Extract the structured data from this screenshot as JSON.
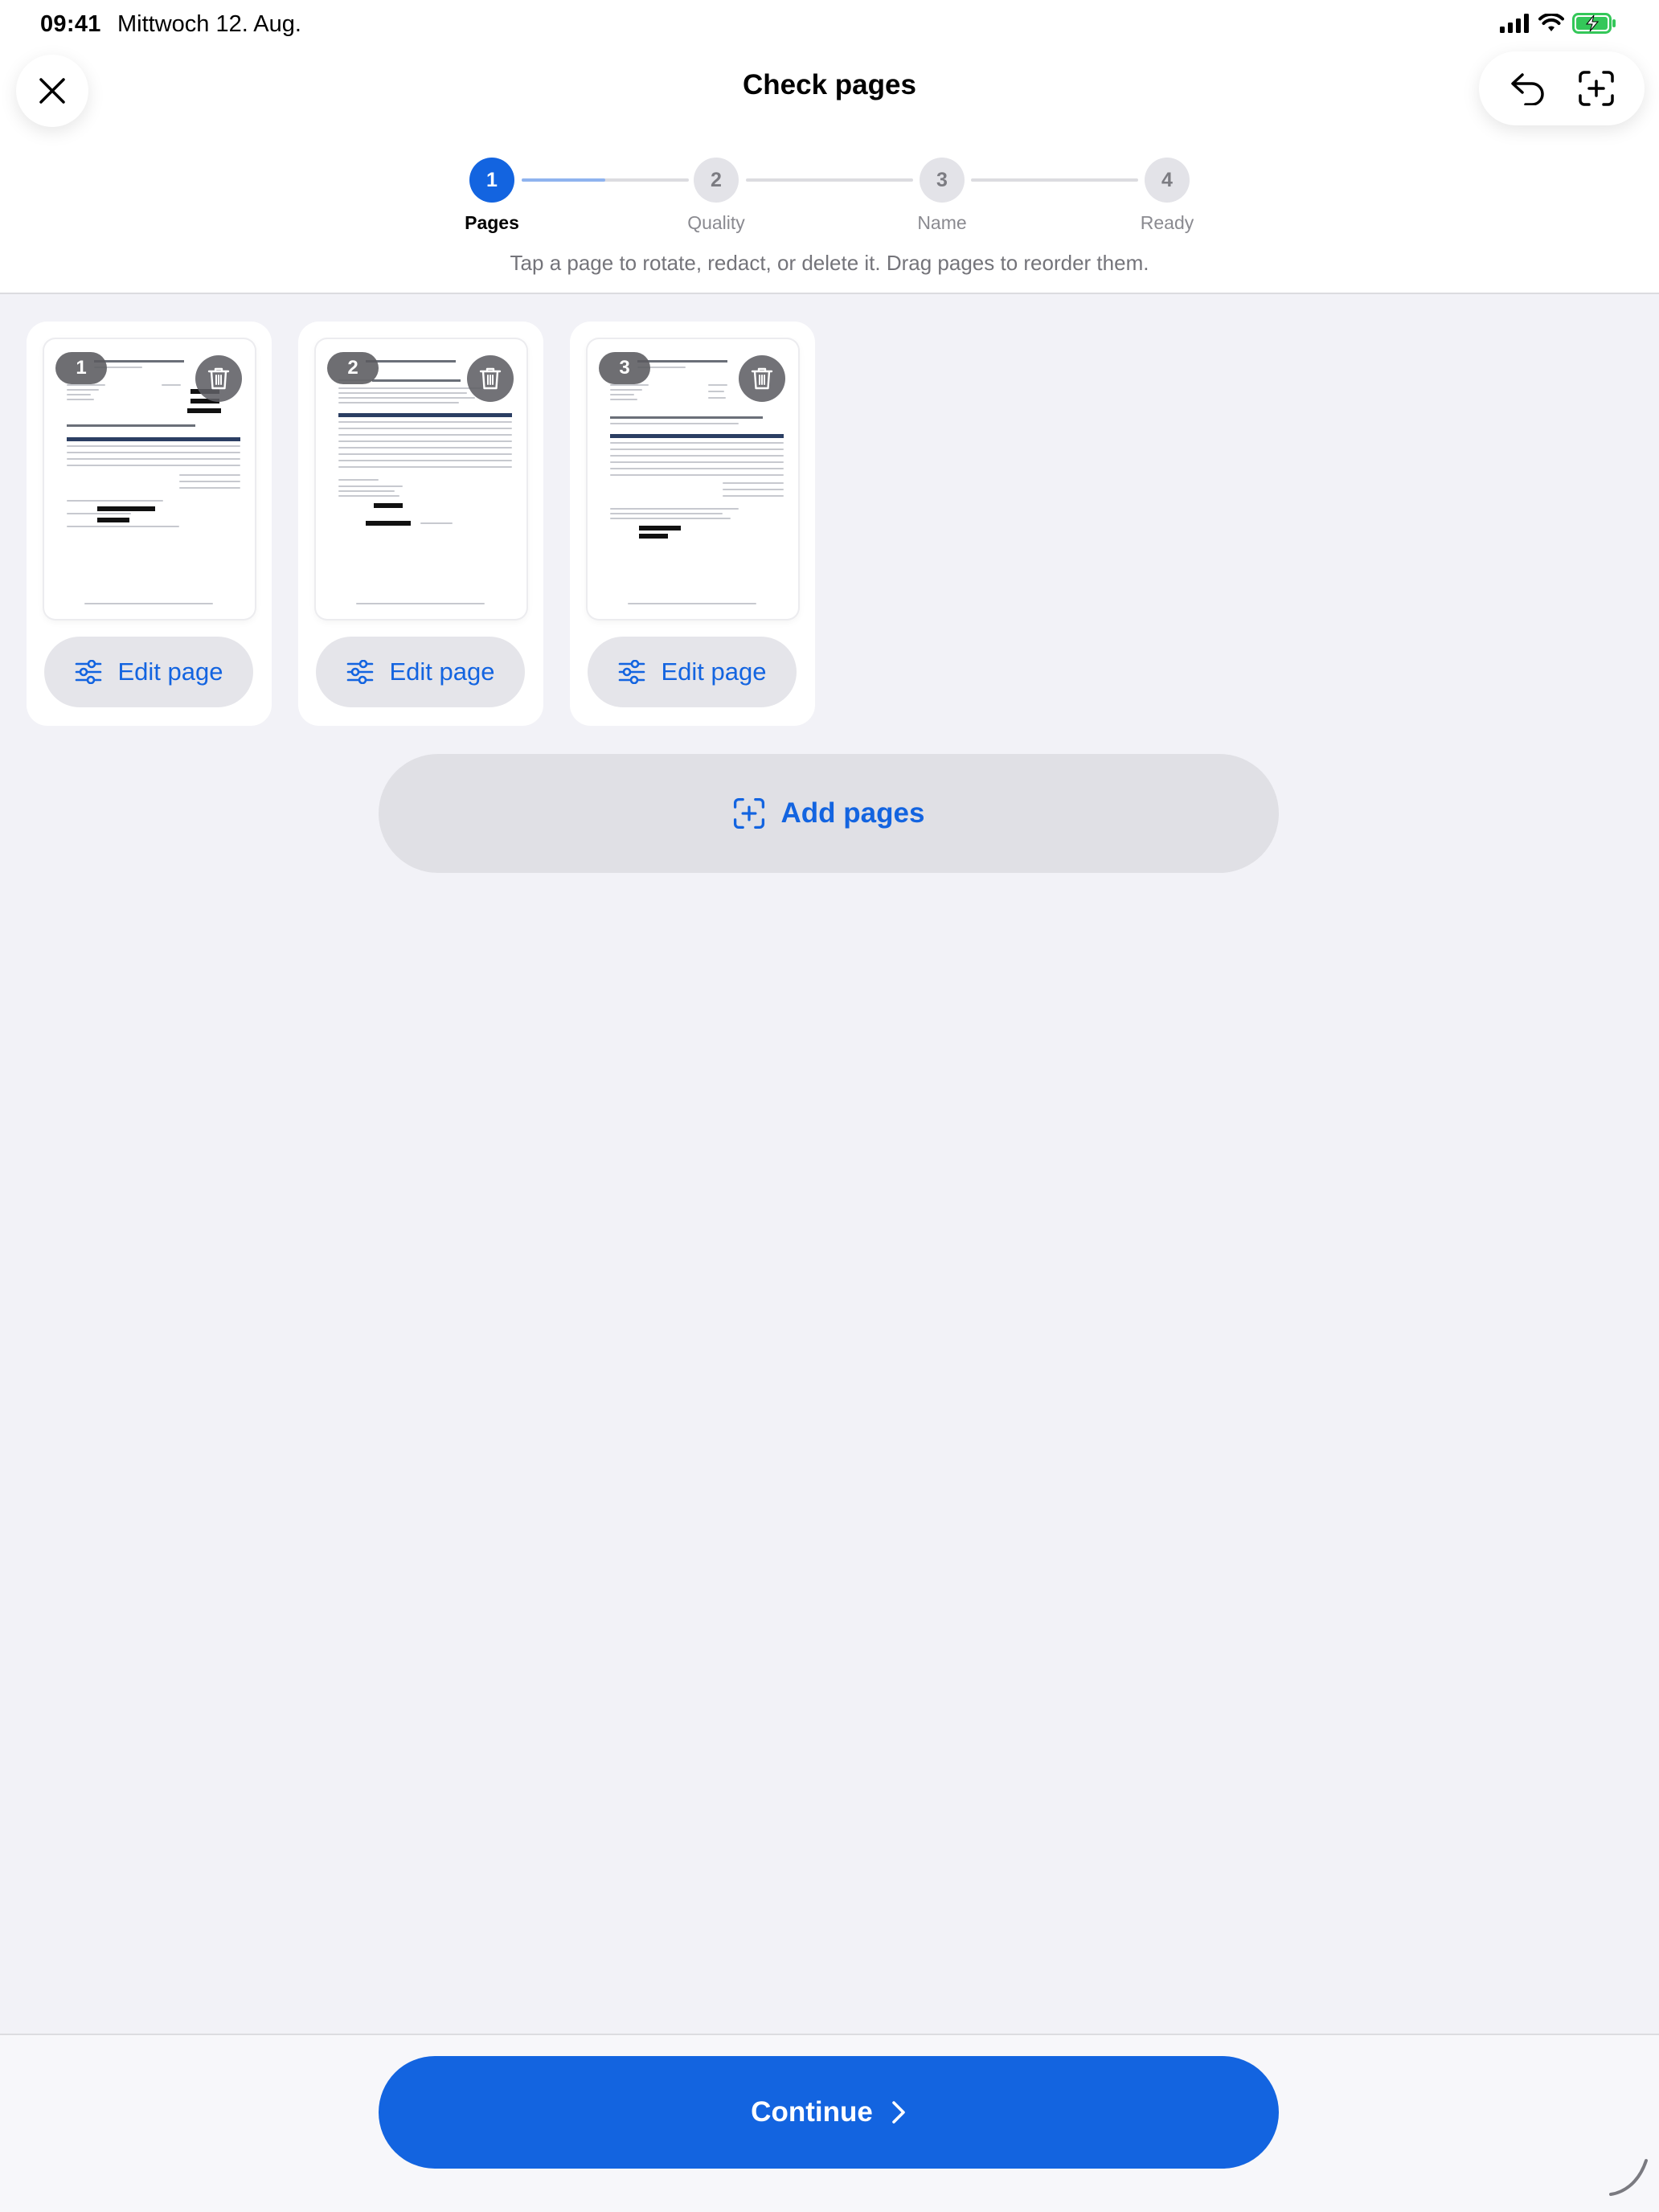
{
  "status_bar": {
    "time": "09:41",
    "date": "Mittwoch 12. Aug."
  },
  "header": {
    "title": "Check pages"
  },
  "stepper": {
    "current_step": 1,
    "steps": [
      {
        "number": "1",
        "label": "Pages"
      },
      {
        "number": "2",
        "label": "Quality"
      },
      {
        "number": "3",
        "label": "Name"
      },
      {
        "number": "4",
        "label": "Ready"
      }
    ]
  },
  "instruction": "Tap a page to rotate, redact, or delete it. Drag pages to reorder them.",
  "pages": [
    {
      "number": "1",
      "edit_label": "Edit page"
    },
    {
      "number": "2",
      "edit_label": "Edit page"
    },
    {
      "number": "3",
      "edit_label": "Edit page"
    }
  ],
  "add_pages_label": "Add pages",
  "continue_label": "Continue",
  "colors": {
    "accent": "#1364e0",
    "background": "#f2f2f7",
    "secondary_button": "#e5e5ea"
  }
}
